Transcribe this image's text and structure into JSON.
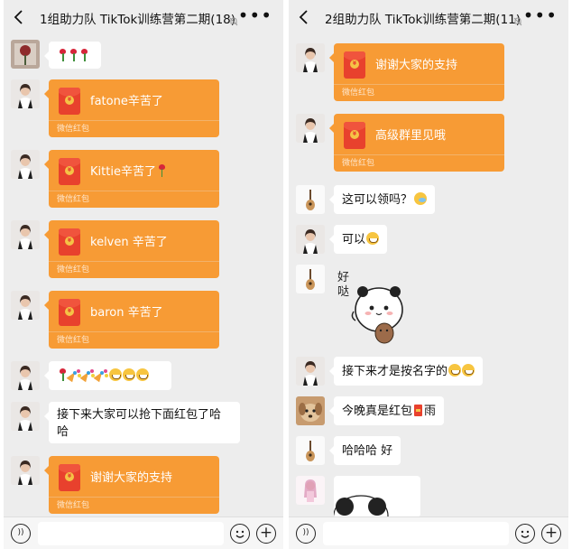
{
  "left": {
    "title": "1组助力队 TikTok训练营第二期(18)",
    "messages": {
      "m1_text": "",
      "m2_text": "fatone辛苦了",
      "m3_text": "Kittie辛苦了",
      "m4_text": "kelven 辛苦了",
      "m5_text": "baron 辛苦了",
      "m7_text": "接下来大家可以抢下面红包了哈哈",
      "m7_line1": "接下来大家可以抢下面红包了哈",
      "m7_line2": "哈",
      "m8_text": "谢谢大家的支持"
    },
    "redpacket_footer": "微信红包"
  },
  "right": {
    "title": "2组助力队 TikTok训练营第二期(11)",
    "messages": {
      "m1_text": "谢谢大家的支持",
      "m2_text": "高级群里见哦",
      "m3_text": "这可以领吗？",
      "m4_text": "可以",
      "m5_sticker_text": "好哒",
      "m6_text": "接下来才是按名字的",
      "m7_text": "今晚真是红包",
      "m7_text2": "雨",
      "m8_text": "哈哈哈 好"
    },
    "redpacket_footer": "微信红包"
  },
  "icons": {
    "back": "chevron-left-icon",
    "mute": "mute-bell-icon",
    "more": "more-dots-icon",
    "voice": "voice-icon",
    "emoji": "emoji-icon",
    "plus": "plus-icon"
  },
  "colors": {
    "background": "#ededed",
    "redpacket": "#f79b35",
    "bubble": "#ffffff",
    "text": "#111111"
  }
}
